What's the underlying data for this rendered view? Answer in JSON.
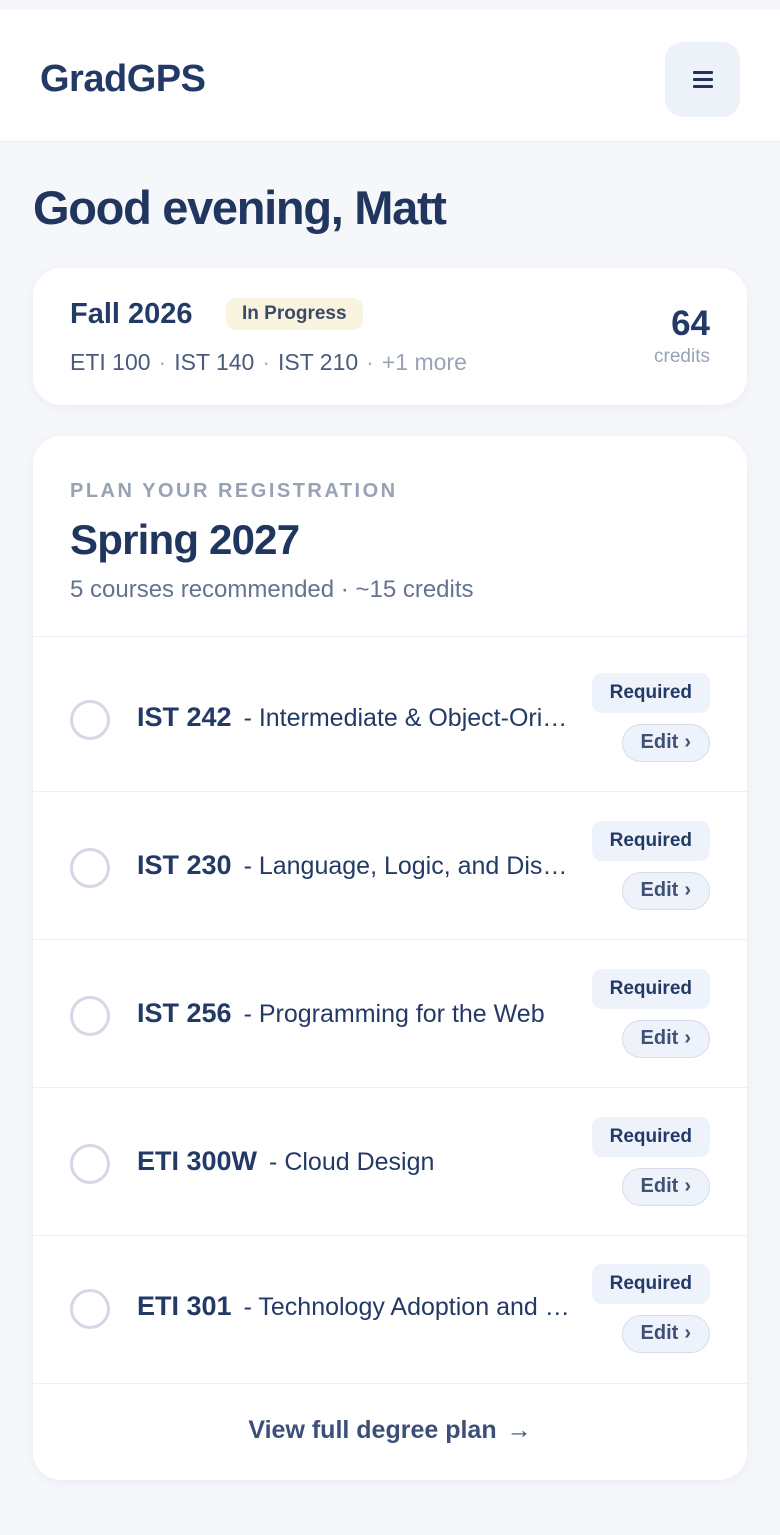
{
  "header": {
    "logo": "GradGPS",
    "menu_icon": "hamburger-menu-icon"
  },
  "greeting": "Good evening, Matt",
  "current_term": {
    "title": "Fall 2026",
    "status": "In Progress",
    "courses": [
      "ETI 100",
      "IST 140",
      "IST 210"
    ],
    "more": "+1 more",
    "credits_value": "64",
    "credits_label": "credits"
  },
  "plan": {
    "eyebrow": "PLAN YOUR REGISTRATION",
    "title": "Spring 2027",
    "subtitle": "5 courses recommended · ~15 credits",
    "courses": [
      {
        "code": "IST 242",
        "name": "- Intermediate & Object-Oriented Application Development",
        "badge": "Required",
        "edit": "Edit"
      },
      {
        "code": "IST 230",
        "name": "- Language, Logic, and Discrete Mathematics",
        "badge": "Required",
        "edit": "Edit"
      },
      {
        "code": "IST 256",
        "name": "- Programming for the Web",
        "badge": "Required",
        "edit": "Edit"
      },
      {
        "code": "ETI 300W",
        "name": "- Cloud Design",
        "badge": "Required",
        "edit": "Edit"
      },
      {
        "code": "ETI 301",
        "name": "- Technology Adoption and Diffusion",
        "badge": "Required",
        "edit": "Edit"
      }
    ],
    "view_full": "View full degree plan",
    "view_full_arrow": "→"
  },
  "colors": {
    "brand": "#243a66",
    "badge_progress_bg": "#f8f4de",
    "badge_required_bg": "#eef2fb",
    "page_bg": "#f5f7fb"
  }
}
